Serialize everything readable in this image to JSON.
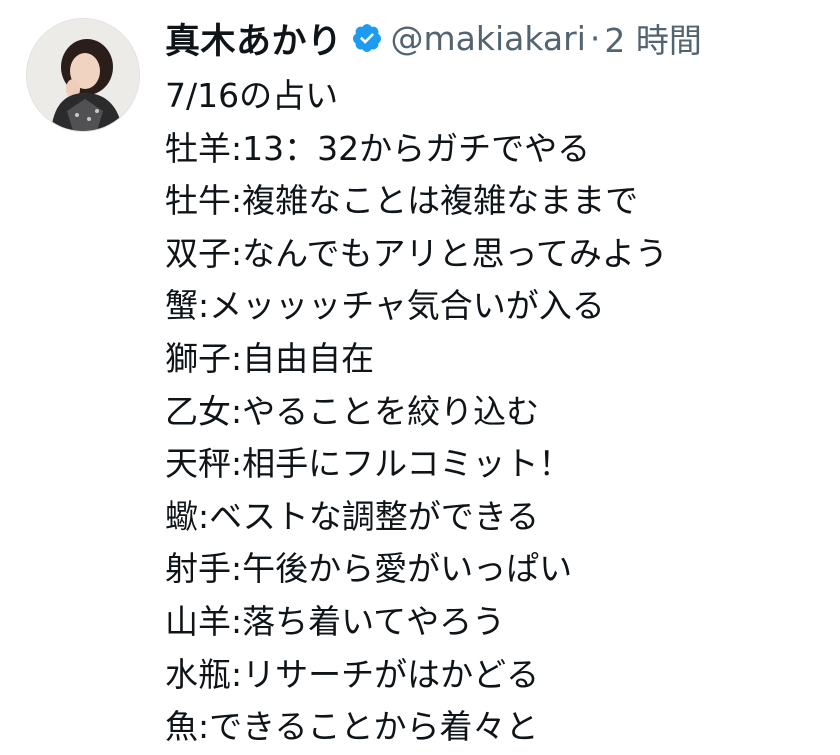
{
  "tweet": {
    "display_name": "真木あかり",
    "handle": "@makiakari",
    "separator": "·",
    "time": "2 時間",
    "verified_color": "#1d9bf0",
    "lines": [
      "7/16の占い",
      "牡羊:13：32からガチでやる",
      "牡牛:複雑なことは複雑なままで",
      "双子:なんでもアリと思ってみよう",
      "蟹:メッッッチャ気合いが入る",
      "獅子:自由自在",
      "乙女:やることを絞り込む",
      "天秤:相手にフルコミット！",
      "蠍:ベストな調整ができる",
      "射手:午後から愛がいっぱい",
      "山羊:落ち着いてやろう",
      "水瓶:リサーチがはかどる",
      "魚:できることから着々と"
    ]
  }
}
